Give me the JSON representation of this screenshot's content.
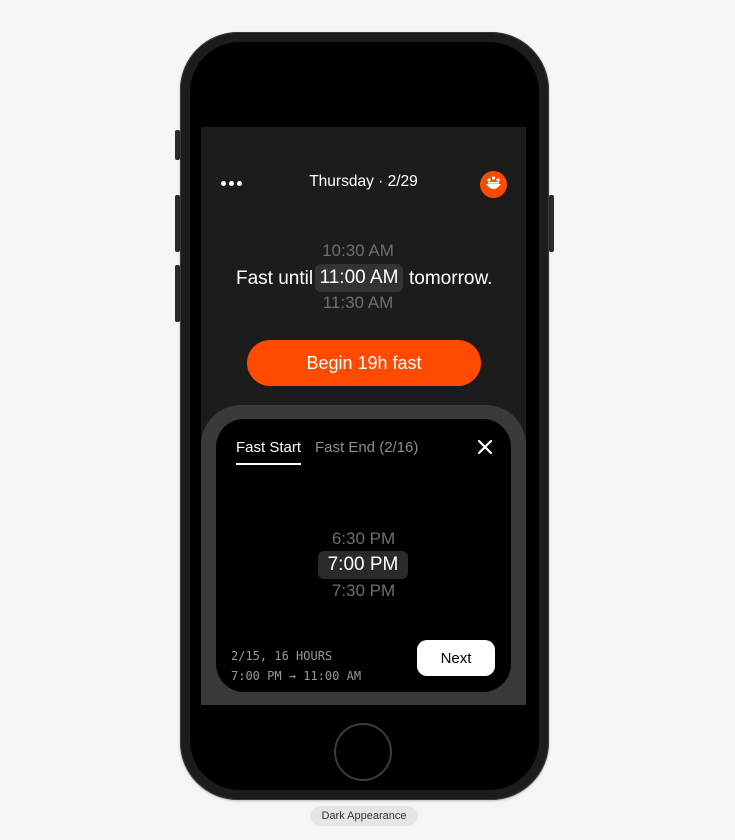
{
  "header": {
    "date_title": "Thursday · 2/29",
    "more_icon": "more-horizontal-icon",
    "avatar_icon": "avatar-icon"
  },
  "fast_target_picker": {
    "prefix": "Fast until",
    "previous_option": "10:30 AM",
    "selected": "11:00 AM",
    "next_option": "11:30 AM",
    "suffix": "tomorrow."
  },
  "begin_button_label": "Begin 19h fast",
  "sheet": {
    "tabs": [
      {
        "label": "Fast Start",
        "active": true
      },
      {
        "label": "Fast End (2/16)",
        "active": false
      }
    ],
    "close_icon": "close-icon",
    "wheel": {
      "previous_option": "6:30 PM",
      "selected": "7:00 PM",
      "next_option": "7:30 PM"
    },
    "summary_line1": "2/15, 16 HOURS",
    "summary_line2": "7:00 PM → 11:00 AM",
    "next_label": "Next"
  },
  "caption": "Dark Appearance",
  "colors": {
    "accent": "#ff4a00",
    "screen_background": "#1c1c1c",
    "sheet_background": "#000000"
  }
}
